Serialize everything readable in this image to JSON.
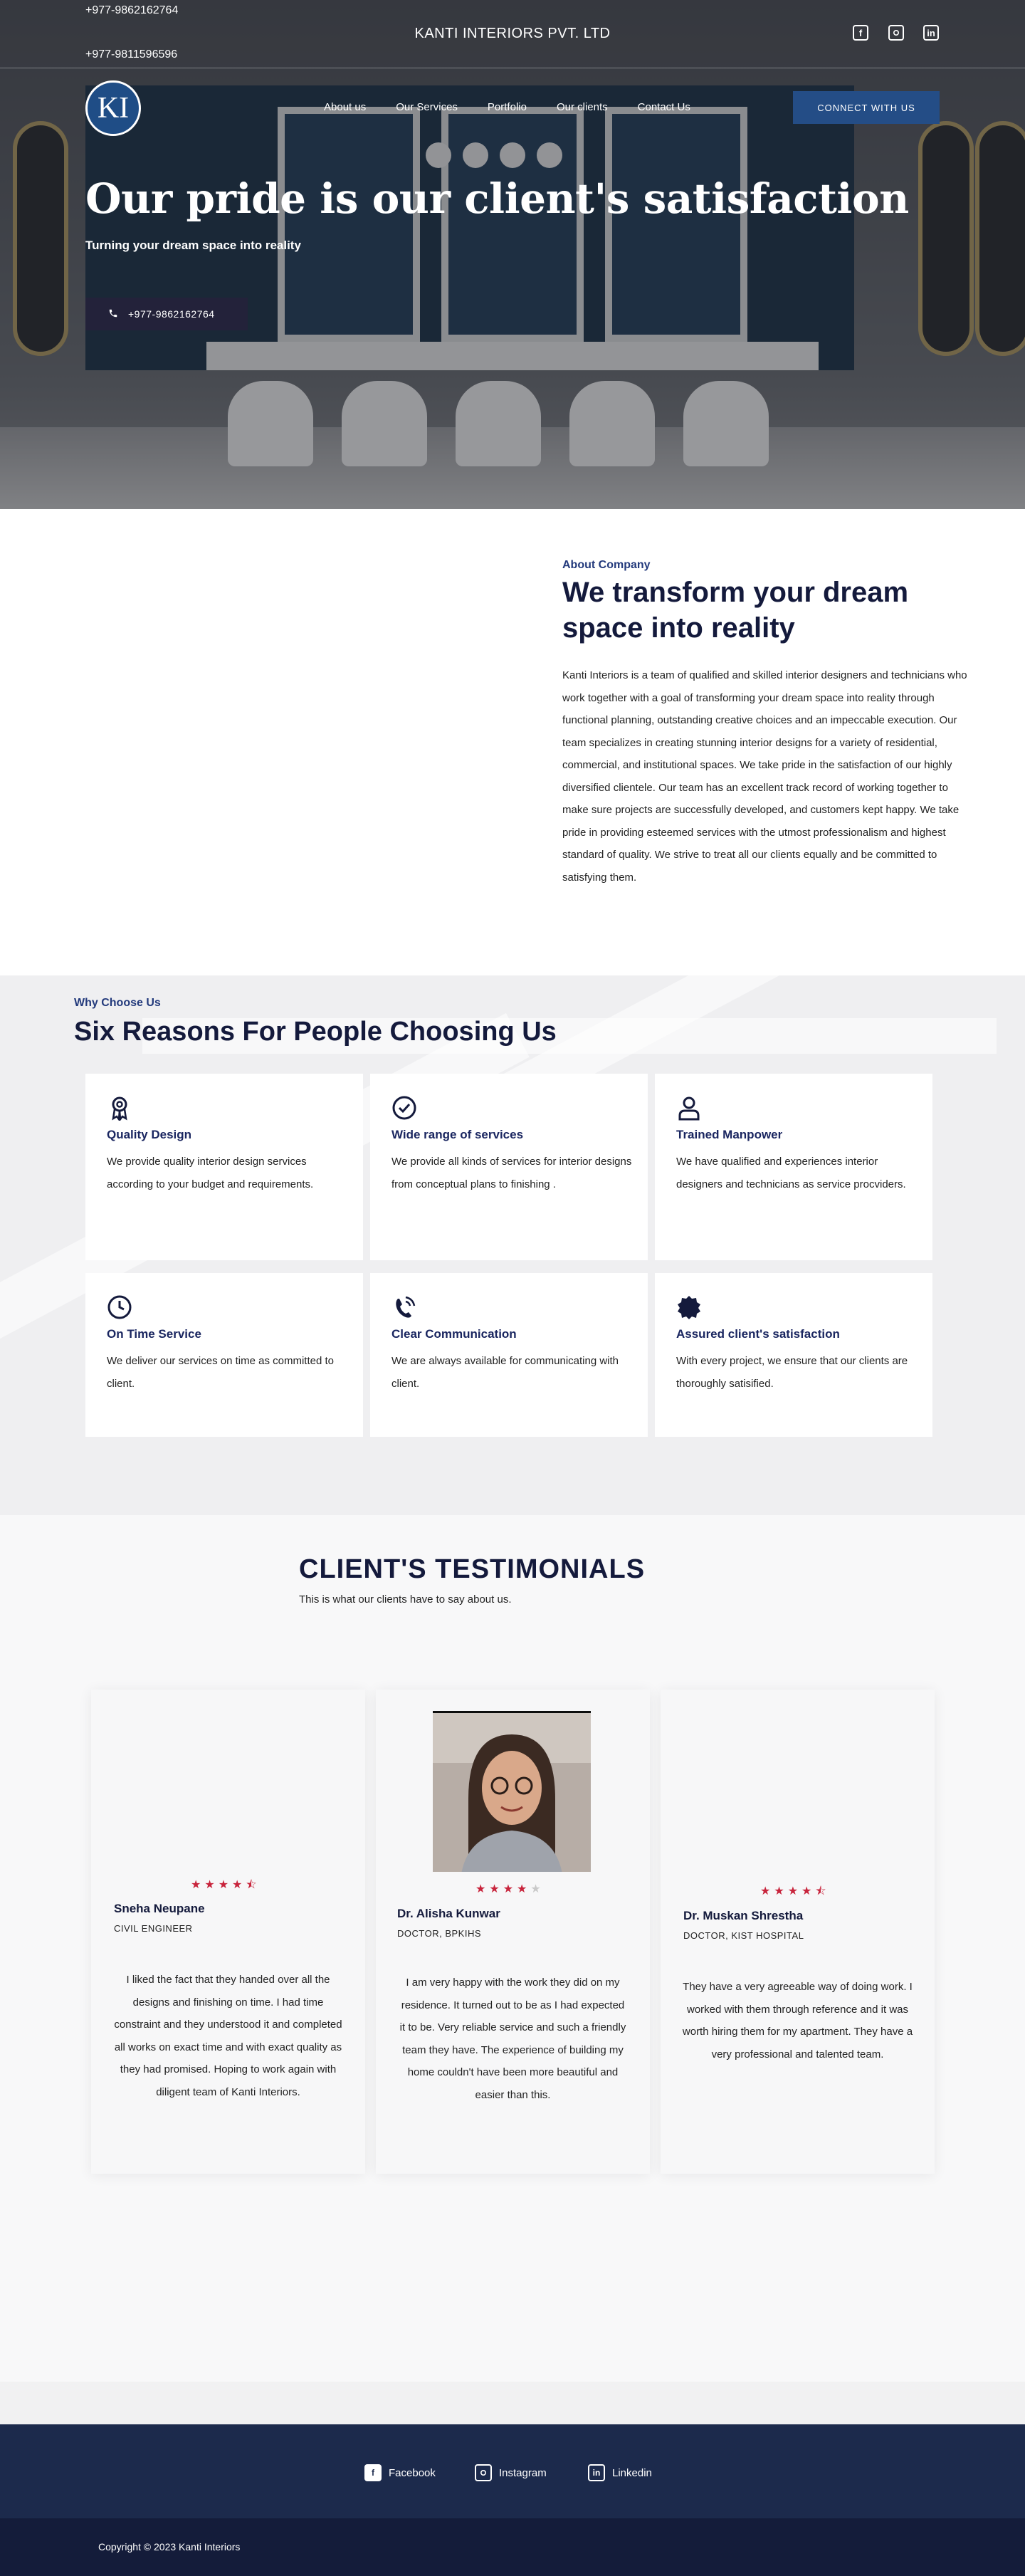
{
  "header": {
    "phones": [
      "+977-9862162764",
      "+977-9811596596"
    ],
    "brand_title": "KANTI INTERIORS PVT. LTD",
    "social_icons": [
      "facebook-icon",
      "instagram-icon",
      "linkedin-icon"
    ],
    "logo_text": "KI"
  },
  "nav": {
    "items": [
      {
        "label": "About us"
      },
      {
        "label": "Our Services"
      },
      {
        "label": "Portfolio"
      },
      {
        "label": "Our clients"
      },
      {
        "label": "Contact Us"
      }
    ],
    "connect_label": "CONNECT WITH US"
  },
  "hero": {
    "heading": "Our pride is our client's satisfaction",
    "subheading": "Turning your dream space into reality",
    "phone_button": "+977-9862162764"
  },
  "about": {
    "eyebrow": "About Company",
    "heading": "We transform your dream space into reality",
    "text": "Kanti Interiors is a team of qualified and skilled interior designers and technicians who work together with a goal of transforming your dream space into reality through functional planning, outstanding creative choices and an impeccable execution. Our team specializes in creating stunning interior designs for a variety of residential, commercial, and institutional spaces. We take pride in the satisfaction of our highly diversified clientele. Our team has an excellent track record of working together to make sure projects are successfully developed, and customers kept happy. We take pride in providing esteemed services with the utmost professionalism and highest standard of quality. We strive to treat all our clients equally and be committed to satisfying them."
  },
  "reasons": {
    "eyebrow": "Why Choose Us",
    "heading": "Six Reasons For People Choosing Us",
    "items": [
      {
        "icon": "award-ribbon-icon",
        "title": "Quality Design",
        "text": "We provide quality interior design services according to your budget and requirements."
      },
      {
        "icon": "check-circle-icon",
        "title": "Wide range of services",
        "text": "We provide all kinds of services for interior designs from conceptual plans to finishing ."
      },
      {
        "icon": "person-icon",
        "title": "Trained Manpower",
        "text": "We have qualified and experiences interior designers and technicians as service procviders."
      },
      {
        "icon": "clock-icon",
        "title": "On Time Service",
        "text": "We deliver our services on time as committed to client."
      },
      {
        "icon": "phone-ringing-icon",
        "title": "Clear Communication",
        "text": "We are always available for communicating with client."
      },
      {
        "icon": "badge-seal-icon",
        "title": "Assured client's satisfaction",
        "text": "With every project, we ensure that our clients are thoroughly satisified."
      }
    ]
  },
  "testimonials": {
    "heading": "CLIENT'S TESTIMONIALS",
    "subheading": "This is what our clients have to say about us.",
    "items": [
      {
        "name": "Sneha Neupane",
        "role": "CIVIL ENGINEER",
        "rating": 4.5,
        "stars": "★★★★⯪",
        "quote": "I liked the fact that they handed over all the designs and finishing on time. I had time constraint and they understood it and completed all works on exact time and with exact quality as they had promised. Hoping to work again with diligent team of Kanti Interiors."
      },
      {
        "name": "Dr. Alisha Kunwar",
        "role": "DOCTOR, BPKIHS",
        "rating": 4,
        "stars": "★★★★",
        "stars_empty": "★",
        "quote": "I am very happy with the work they did on my residence. It turned out to be as I had expected it to be. Very reliable service and such a friendly team they have. The experience of building my home couldn't have been more beautiful and easier than this."
      },
      {
        "name": "Dr. Muskan Shrestha",
        "role": "DOCTOR, KIST HOSPITAL",
        "rating": 4.5,
        "stars": "★★★★⯪",
        "quote": "They have a very agreeable way of doing work. I worked with them through reference and it was worth hiring them for my apartment. They have a very professional and talented team."
      }
    ]
  },
  "footer": {
    "links": [
      {
        "icon": "facebook-icon",
        "label": "Facebook"
      },
      {
        "icon": "instagram-icon",
        "label": "Instagram"
      },
      {
        "icon": "linkedin-icon",
        "label": "Linkedin"
      }
    ],
    "copyright": "Copyright © 2023 Kanti Interiors"
  },
  "colors": {
    "accent_blue": "#244d86",
    "heading_navy": "#141a3c",
    "star_red": "#c8243c",
    "footer_bg": "#1c2a4c",
    "copyright_bg": "#141c3a"
  }
}
